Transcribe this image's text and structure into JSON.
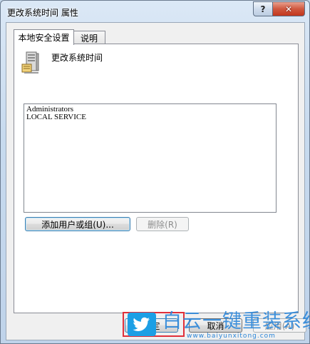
{
  "window": {
    "title": "更改系统时间 属性"
  },
  "caption_buttons": {
    "help": "?",
    "close": "✕"
  },
  "tabs": [
    {
      "label": "本地安全设置"
    },
    {
      "label": "说明"
    }
  ],
  "policy": {
    "icon": "computer-icon",
    "name": "更改系统时间"
  },
  "user_list": {
    "items": [
      "Administrators",
      "LOCAL SERVICE"
    ]
  },
  "buttons": {
    "add": "添加用户或组(U)...",
    "remove": "删除(R)",
    "ok": "确定",
    "cancel": "取消",
    "apply": "应用(A)"
  },
  "watermark": {
    "title": "白云一键重装系统",
    "url": "www.baiyunxitong.com",
    "icon": "twitter-bird-icon"
  },
  "colors": {
    "highlight_box": "#e0303a",
    "watermark": "#2b86d9"
  }
}
